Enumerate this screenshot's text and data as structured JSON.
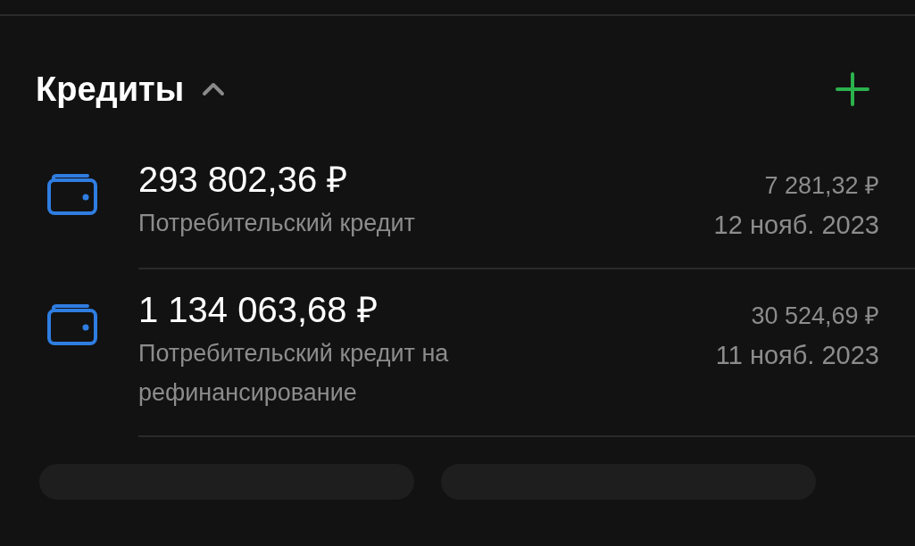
{
  "section": {
    "title": "Кредиты",
    "expanded": true
  },
  "loans": [
    {
      "amount": "293 802,36 ₽",
      "name": "Потребительский кредит",
      "payment": "7 281,32 ₽",
      "date": "12 нояб. 2023"
    },
    {
      "amount": "1 134 063,68 ₽",
      "name": "Потребительский кредит на рефинансирование",
      "payment": "30 524,69 ₽",
      "date": "11 нояб. 2023"
    }
  ]
}
